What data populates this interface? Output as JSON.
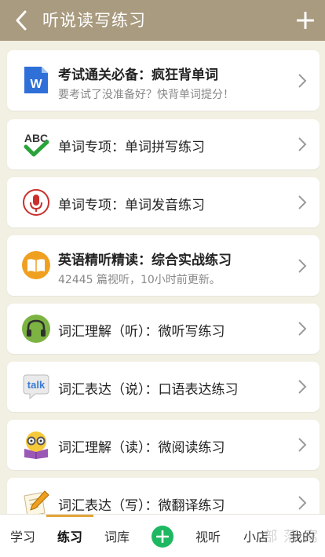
{
  "header": {
    "title": "听说读写练习",
    "back_icon": "chevron-left-icon",
    "add_icon": "plus-icon"
  },
  "items": [
    {
      "title": "考试通关必备：疯狂背单词",
      "subtitle": "要考试了没准备好？快背单词提分！",
      "icon": "word-doc-icon",
      "bold": true
    },
    {
      "title": "单词专项：单词拼写练习",
      "icon": "abc-check-icon"
    },
    {
      "title": "单词专项：单词发音练习",
      "icon": "microphone-icon"
    },
    {
      "title": "英语精听精读：综合实战练习",
      "subtitle": "42445 篇视听，10小时前更新。",
      "icon": "book-icon",
      "bold": true
    },
    {
      "title": "词汇理解（听）：微听写练习",
      "icon": "headphones-icon"
    },
    {
      "title": "词汇表达（说）：口语表达练习",
      "icon": "talk-bubble-icon"
    },
    {
      "title": "词汇理解（读）：微阅读练习",
      "icon": "reading-glasses-icon"
    },
    {
      "title": "词汇表达（写）：微翻译练习",
      "icon": "pencil-paper-icon"
    }
  ],
  "tabs": [
    "学习",
    "练习",
    "词库",
    "视听",
    "小店",
    "我的"
  ],
  "active_tab": "练习",
  "watermark": "部 落 窝",
  "colors": {
    "header": "#a99b7f",
    "accent": "#e2a53a",
    "add": "#1db861",
    "background": "#f2efe3"
  }
}
